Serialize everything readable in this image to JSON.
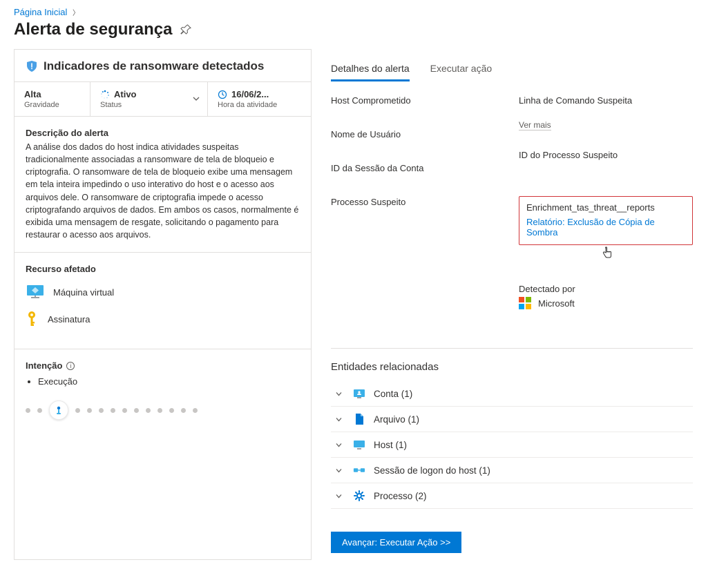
{
  "breadcrumb": {
    "home": "Página Inicial"
  },
  "page_title": "Alerta de segurança",
  "alert": {
    "title": "Indicadores de ransomware detectados",
    "severity_value": "Alta",
    "severity_label": "Gravidade",
    "status_value": "Ativo",
    "status_label": "Status",
    "time_value": "16/06/2...",
    "time_label": "Hora da atividade",
    "description_title": "Descrição do alerta",
    "description_text": "A análise dos dados do host indica atividades suspeitas tradicionalmente associadas a ransomware de tela de bloqueio e criptografia. O ransomware de tela de bloqueio exibe uma mensagem em tela inteira impedindo o uso interativo do host e o acesso aos arquivos dele. O ransomware de criptografia impede o acesso criptografando arquivos de dados. Em ambos os casos, normalmente é exibida uma mensagem de resgate, solicitando o pagamento para restaurar o acesso aos arquivos."
  },
  "affected": {
    "title": "Recurso afetado",
    "vm": "Máquina virtual",
    "subscription": "Assinatura"
  },
  "intent": {
    "title": "Intenção",
    "item": "Execução"
  },
  "tabs": {
    "details": "Detalhes do alerta",
    "action": "Executar ação"
  },
  "details": {
    "host": "Host Comprometido",
    "cmdline": "Linha de Comando Suspeita",
    "vermais": "Ver mais",
    "username": "Nome de Usuário",
    "pid": "ID do Processo Suspeito",
    "session": "ID da Sessão da Conta",
    "enrichment_label": "Enrichment_tas_threat__reports",
    "enrichment_link": "Relatório: Exclusão de Cópia de Sombra",
    "process": "Processo Suspeito",
    "detected_by_label": "Detectado por",
    "detected_by_value": "Microsoft"
  },
  "entities": {
    "title": "Entidades relacionadas",
    "items": [
      {
        "label": "Conta (1)",
        "icon": "account"
      },
      {
        "label": "Arquivo (1)",
        "icon": "file"
      },
      {
        "label": "Host (1)",
        "icon": "host"
      },
      {
        "label": "Sessão de logon do host (1)",
        "icon": "session"
      },
      {
        "label": "Processo (2)",
        "icon": "process"
      }
    ]
  },
  "action_button": "Avançar: Executar Ação >>"
}
